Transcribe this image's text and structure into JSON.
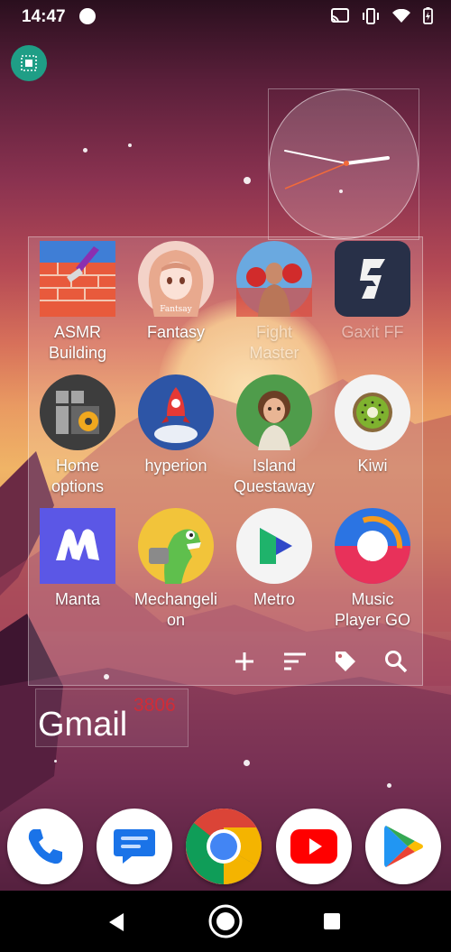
{
  "status_bar": {
    "time": "14:47",
    "icons": [
      "notification-dot",
      "cast-icon",
      "vibrate-icon",
      "wifi-icon",
      "battery-charging-icon"
    ]
  },
  "select_mode_button": {
    "icon": "select-icon",
    "color": "#1f9e86"
  },
  "clock_widget": {
    "type": "analog"
  },
  "app_drawer": {
    "apps": [
      {
        "label": "ASMR\nBuilding",
        "icon": "asmr-building-icon"
      },
      {
        "label": "Fantasy",
        "icon": "fantasy-icon"
      },
      {
        "label": "Fight\nMaster",
        "icon": "fight-master-icon"
      },
      {
        "label": "Gaxit FF",
        "icon": "gaxit-ff-icon"
      },
      {
        "label": "Home\noptions",
        "icon": "home-options-icon"
      },
      {
        "label": "hyperion",
        "icon": "hyperion-icon"
      },
      {
        "label": "Island\nQuestaway",
        "icon": "island-questaway-icon"
      },
      {
        "label": "Kiwi",
        "icon": "kiwi-icon"
      },
      {
        "label": "Manta",
        "icon": "manta-icon"
      },
      {
        "label": "Mechangeli\non",
        "icon": "mechangelion-icon"
      },
      {
        "label": "Metro",
        "icon": "metro-icon"
      },
      {
        "label": "Music\nPlayer GO",
        "icon": "music-player-go-icon"
      }
    ],
    "tools": [
      "add-icon",
      "sort-icon",
      "tag-icon",
      "search-icon"
    ]
  },
  "gmail_widget": {
    "label": "Gmail",
    "count": "3806"
  },
  "dock": [
    "phone-icon",
    "messages-icon",
    "chrome-icon",
    "youtube-icon",
    "play-store-icon"
  ],
  "nav_bar": [
    "back-button",
    "home-button",
    "recents-button"
  ]
}
